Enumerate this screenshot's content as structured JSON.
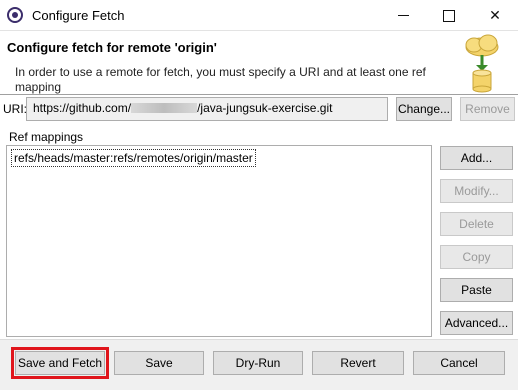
{
  "window": {
    "title": "Configure Fetch",
    "controls": {
      "minimize": "–",
      "maximize": "□",
      "close": "✕"
    }
  },
  "header": {
    "title": "Configure fetch for remote 'origin'",
    "message": "In order to use a remote for fetch, you must specify a URI and at least one ref mapping",
    "icon": "cloud-database-icon"
  },
  "uri": {
    "label": "URI:",
    "value_prefix": "https://github.com/",
    "value_suffix": "/java-jungsuk-exercise.git",
    "change_label": "Change...",
    "remove_label": "Remove"
  },
  "ref_mappings": {
    "label": "Ref mappings",
    "items": [
      "refs/heads/master:refs/remotes/origin/master"
    ],
    "buttons": {
      "add": "Add...",
      "modify": "Modify...",
      "delete": "Delete",
      "copy": "Copy",
      "paste": "Paste",
      "advanced": "Advanced..."
    }
  },
  "footer": {
    "save_and_fetch": "Save and Fetch",
    "save": "Save",
    "dry_run": "Dry-Run",
    "revert": "Revert",
    "cancel": "Cancel"
  },
  "colors": {
    "highlight": "#e0151b",
    "button_bg": "#e1e1e1",
    "disabled_text": "#9a9a9a"
  }
}
